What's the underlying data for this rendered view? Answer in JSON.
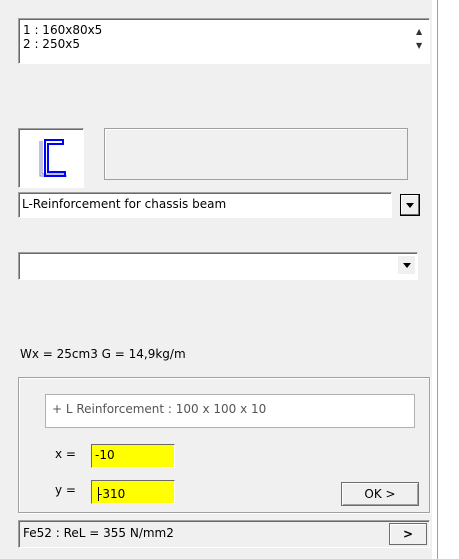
{
  "profiles_list": {
    "items": [
      "1 : 160x80x5",
      "2 : 250x5"
    ]
  },
  "section_icon": {
    "name": "c-channel-icon",
    "colors": {
      "frame": "#0000ff",
      "shadow": "#8080c0"
    }
  },
  "reinforcement_type": {
    "value": "L-Reinforcement for chassis beam"
  },
  "secondary_select": {
    "value": ""
  },
  "properties": {
    "text": "Wx = 25cm3   G = 14,9kg/m"
  },
  "reinforcement_panel": {
    "description": "+ L Reinforcement : 100 x 100 x 10",
    "x_label": "x =",
    "x_value": "-10",
    "y_label": "y =",
    "y_value": "-310",
    "ok_label": "OK >"
  },
  "material": {
    "text": "Fe52 : ReL = 355 N/mm2",
    "next_label": ">"
  },
  "colors": {
    "highlight_input": "#ffff00",
    "panel_bg": "#f0f0f0"
  }
}
